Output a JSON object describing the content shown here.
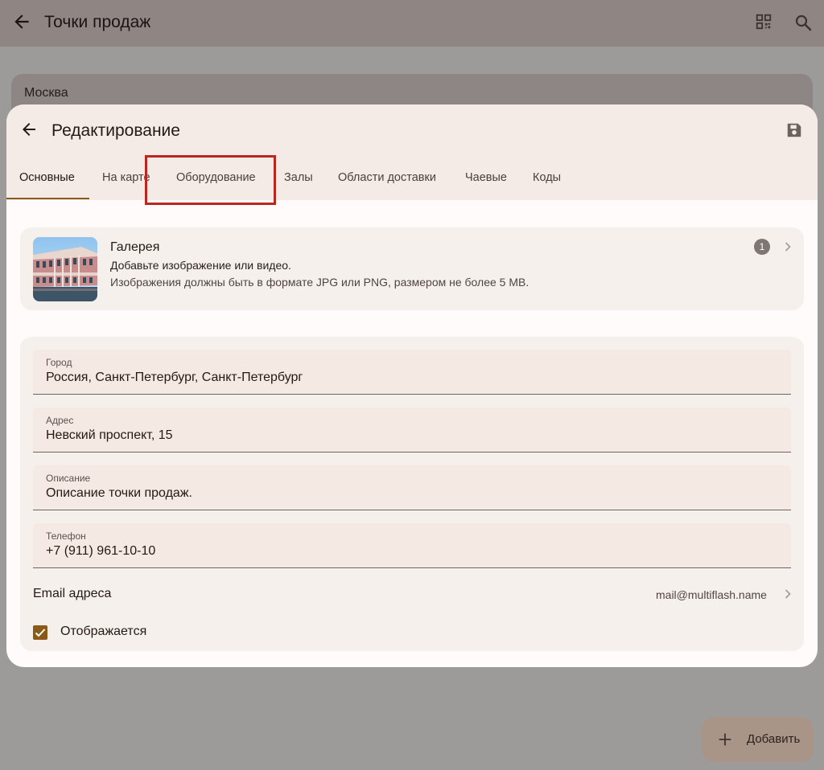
{
  "background": {
    "title": "Точки продаж",
    "list_item": "Москва",
    "fab_label": "Добавить"
  },
  "dialog": {
    "title": "Редактирование",
    "tabs": [
      "Основные",
      "На карте",
      "Оборудование",
      "Залы",
      "Области доставки",
      "Чаевые",
      "Коды"
    ],
    "active_tab": "Основные",
    "gallery": {
      "title": "Галерея",
      "subtitle": "Добавьте изображение или видео.",
      "hint": "Изображения должны быть в формате JPG или PNG, размером не более 5 MB.",
      "count": "1"
    },
    "fields": [
      {
        "label": "Город",
        "value": "Россия, Санкт-Петербург, Санкт-Петербург"
      },
      {
        "label": "Адрес",
        "value": "Невский проспект, 15"
      },
      {
        "label": "Описание",
        "value": "Описание точки продаж."
      },
      {
        "label": "Телефон",
        "value": "+7 (911) 961-10-10"
      }
    ],
    "email": {
      "label": "Email адреса",
      "value": "mail@multiflash.name"
    },
    "visible": {
      "label": "Отображается",
      "checked": true
    }
  },
  "colors": {
    "accent": "#8a5a19",
    "highlight": "#b8281e",
    "header_bg": "#f4ebe6",
    "card_bg": "#f6f0ed",
    "field_bg": "#f5e9e4"
  },
  "icons": {
    "back": "arrow-left-icon",
    "qr": "qr-code-icon",
    "search": "search-icon",
    "save": "save-icon",
    "chevron": "chevron-right-icon",
    "add": "plus-icon",
    "check": "check-icon"
  }
}
